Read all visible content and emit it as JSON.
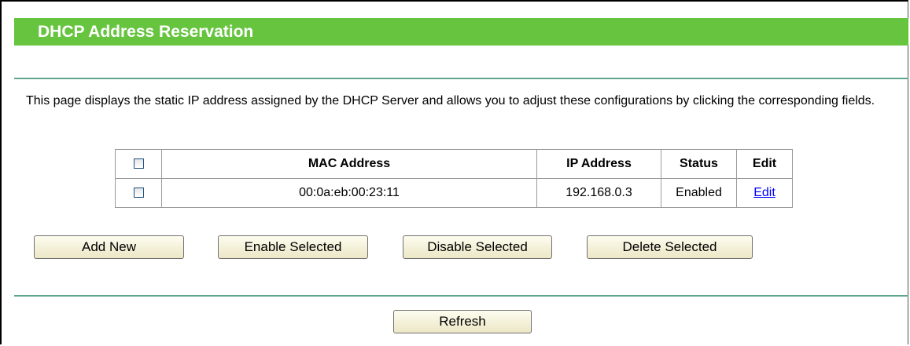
{
  "header": {
    "title": "DHCP Address Reservation"
  },
  "description": "This page displays the static IP address assigned by the DHCP Server and allows you to adjust these configurations by clicking the corresponding fields.",
  "table": {
    "headers": {
      "mac": "MAC Address",
      "ip": "IP Address",
      "status": "Status",
      "edit": "Edit"
    },
    "rows": [
      {
        "mac": "00:0a:eb:00:23:11",
        "ip": "192.168.0.3",
        "status": "Enabled",
        "edit": "Edit"
      }
    ]
  },
  "buttons": {
    "add_new": "Add New",
    "enable_selected": "Enable Selected",
    "disable_selected": "Disable Selected",
    "delete_selected": "Delete Selected",
    "refresh": "Refresh"
  },
  "colors": {
    "title_bar": "#66c43f",
    "rule": "#5da58b",
    "link": "#0000ff"
  }
}
